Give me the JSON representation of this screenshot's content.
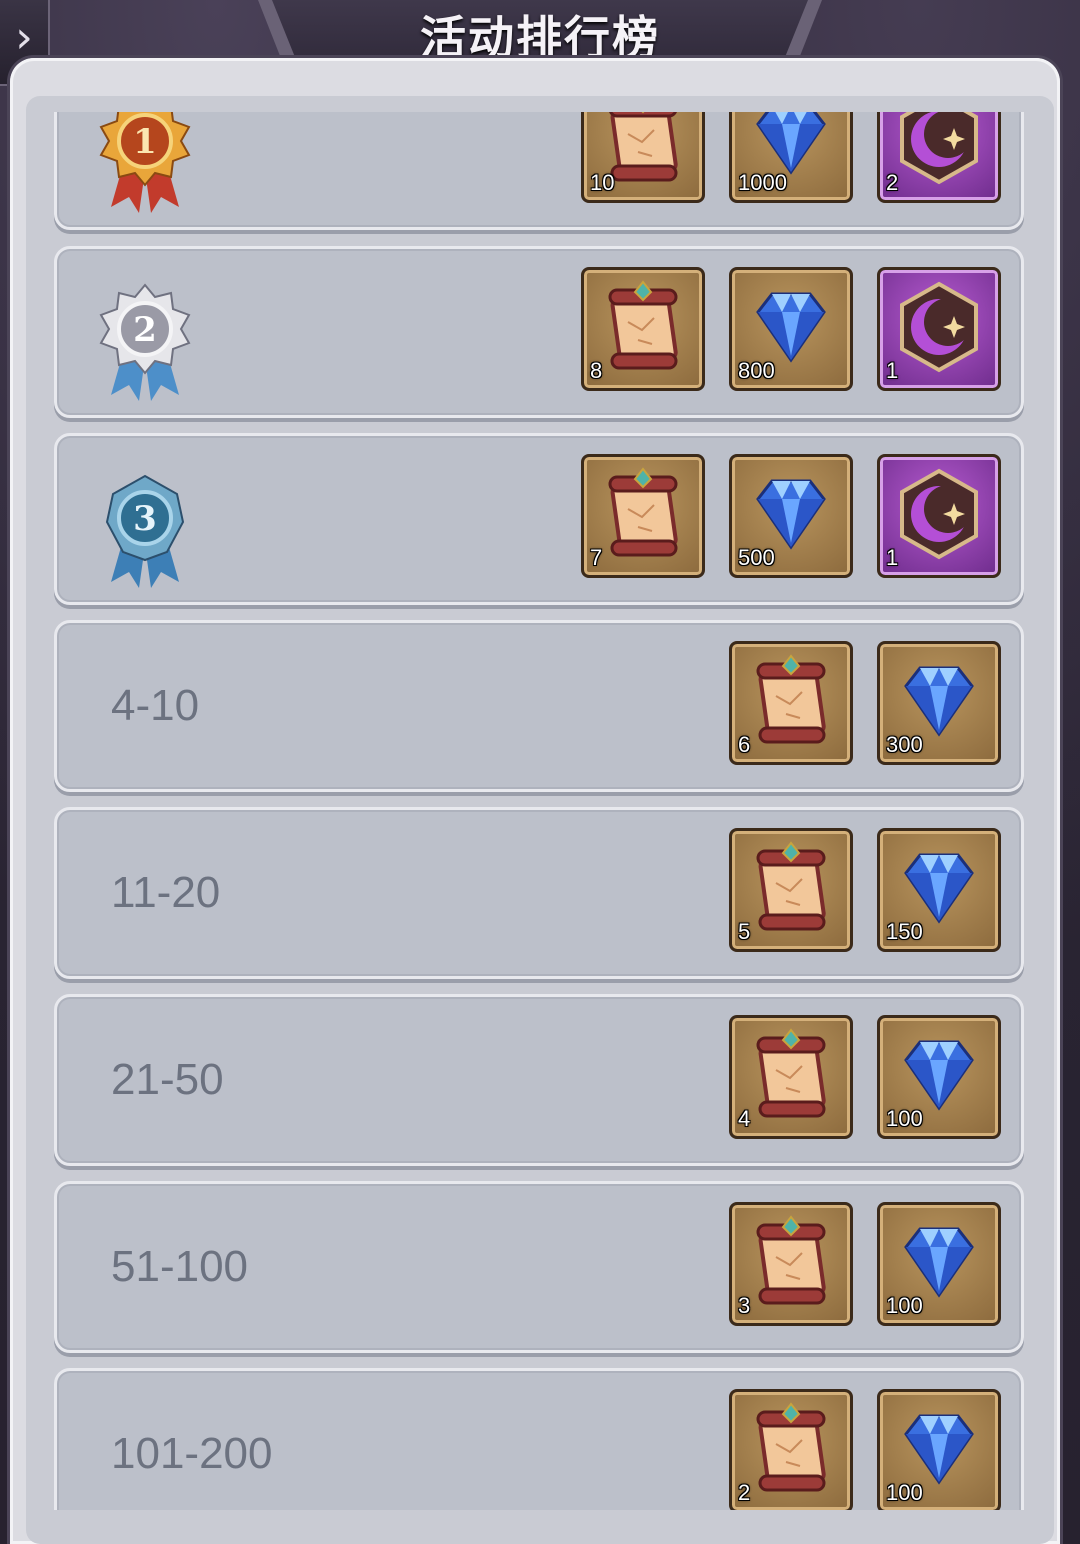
{
  "header": {
    "title": "活动排行榜",
    "back_icon": "chevron-right-icon"
  },
  "colors": {
    "panel": "#c9cbd3",
    "row": "#bcc0ca",
    "item_brown": "#8c6a3d",
    "item_purple": "#6e2c8c"
  },
  "rows": [
    {
      "rank": "",
      "medal": "gold-medal-1-icon",
      "rewards": [
        {
          "icon": "scroll-icon",
          "qty": "10"
        },
        {
          "icon": "diamond-icon",
          "qty": "1000"
        },
        {
          "icon": "moon-emblem-icon",
          "qty": "2"
        }
      ]
    },
    {
      "rank": "",
      "medal": "silver-medal-2-icon",
      "rewards": [
        {
          "icon": "scroll-icon",
          "qty": "8"
        },
        {
          "icon": "diamond-icon",
          "qty": "800"
        },
        {
          "icon": "moon-emblem-icon",
          "qty": "1"
        }
      ]
    },
    {
      "rank": "",
      "medal": "blue-medal-3-icon",
      "rewards": [
        {
          "icon": "scroll-icon",
          "qty": "7"
        },
        {
          "icon": "diamond-icon",
          "qty": "500"
        },
        {
          "icon": "moon-emblem-icon",
          "qty": "1"
        }
      ]
    },
    {
      "rank": "4-10",
      "rewards": [
        {
          "icon": "scroll-icon",
          "qty": "6"
        },
        {
          "icon": "diamond-icon",
          "qty": "300"
        }
      ]
    },
    {
      "rank": "11-20",
      "rewards": [
        {
          "icon": "scroll-icon",
          "qty": "5"
        },
        {
          "icon": "diamond-icon",
          "qty": "150"
        }
      ]
    },
    {
      "rank": "21-50",
      "rewards": [
        {
          "icon": "scroll-icon",
          "qty": "4"
        },
        {
          "icon": "diamond-icon",
          "qty": "100"
        }
      ]
    },
    {
      "rank": "51-100",
      "rewards": [
        {
          "icon": "scroll-icon",
          "qty": "3"
        },
        {
          "icon": "diamond-icon",
          "qty": "100"
        }
      ]
    },
    {
      "rank": "101-200",
      "rewards": [
        {
          "icon": "scroll-icon",
          "qty": "2"
        },
        {
          "icon": "diamond-icon",
          "qty": "100"
        }
      ]
    }
  ]
}
